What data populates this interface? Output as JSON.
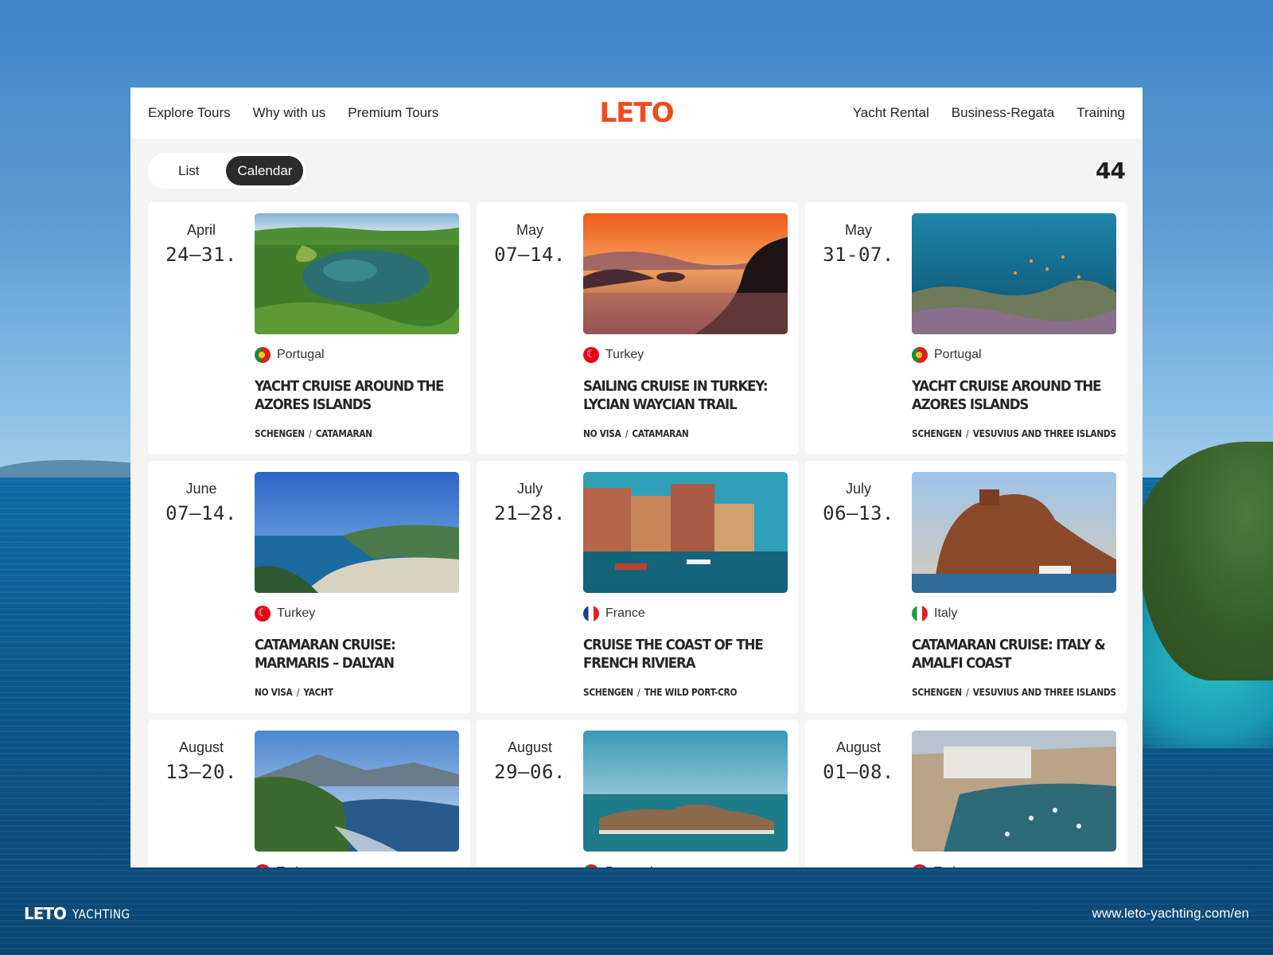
{
  "nav": {
    "left": [
      "Explore Tours",
      "Why with us",
      "Premium Tours"
    ],
    "logo": "LETO",
    "right": [
      "Yacht Rental",
      "Business-Regata",
      "Training"
    ]
  },
  "toolbar": {
    "view_list": "List",
    "view_calendar": "Calendar",
    "active_view": "Calendar",
    "count": "44"
  },
  "tours": [
    {
      "month": "April",
      "days": "24–31.",
      "country": "Portugal",
      "flag": "pt",
      "title": "Yacht cruise around the Azores Islands",
      "tags": [
        "SCHENGEN",
        "CATAMARAN"
      ],
      "photo": "azores-crater-lake"
    },
    {
      "month": "May",
      "days": "07–14.",
      "country": "Turkey",
      "flag": "tr",
      "title": "Sailing cruise in Turkey: Lycian Waycian Trail",
      "tags": [
        "NO VISA",
        "CATAMARAN"
      ],
      "photo": "sunset-islands"
    },
    {
      "month": "May",
      "days": "31-07.",
      "country": "Portugal",
      "flag": "pt",
      "title": "Yacht cruise around the Azores Islands",
      "tags": [
        "SCHENGEN",
        "VESUVIUS AND THREE ISLANDS"
      ],
      "photo": "coral-reef"
    },
    {
      "month": "June",
      "days": "07–14.",
      "country": "Turkey",
      "flag": "tr",
      "title": "Catamaran cruise: Marmaris – Dalyan",
      "tags": [
        "NO VISA",
        "YACHT"
      ],
      "photo": "lagoon-beach"
    },
    {
      "month": "July",
      "days": "21–28.",
      "country": "France",
      "flag": "fr",
      "title": "Cruise the coast of the French Riviera",
      "tags": [
        "SCHENGEN",
        "THE WILD PORT-CRO"
      ],
      "photo": "harbor-town"
    },
    {
      "month": "July",
      "days": "06–13.",
      "country": "Italy",
      "flag": "it",
      "title": "Catamaran cruise: Italy & Amalfi Coast",
      "tags": [
        "SCHENGEN",
        "VESUVIUS AND THREE ISLANDS"
      ],
      "photo": "castle-rock"
    },
    {
      "month": "August",
      "days": "13–20.",
      "country": "Turkey",
      "flag": "tr",
      "title": "",
      "tags": [],
      "photo": "coastal-cliffs"
    },
    {
      "month": "August",
      "days": "29–06.",
      "country": "Portugal",
      "flag": "pt",
      "title": "",
      "tags": [],
      "photo": "volcanic-island"
    },
    {
      "month": "August",
      "days": "01–08.",
      "country": "Turkey",
      "flag": "tr",
      "title": "",
      "tags": [],
      "photo": "fishing-harbor"
    }
  ],
  "footer": {
    "brand_logo": "LETO",
    "brand_word": "YACHTING",
    "url": "www.leto-yachting.com/en"
  }
}
